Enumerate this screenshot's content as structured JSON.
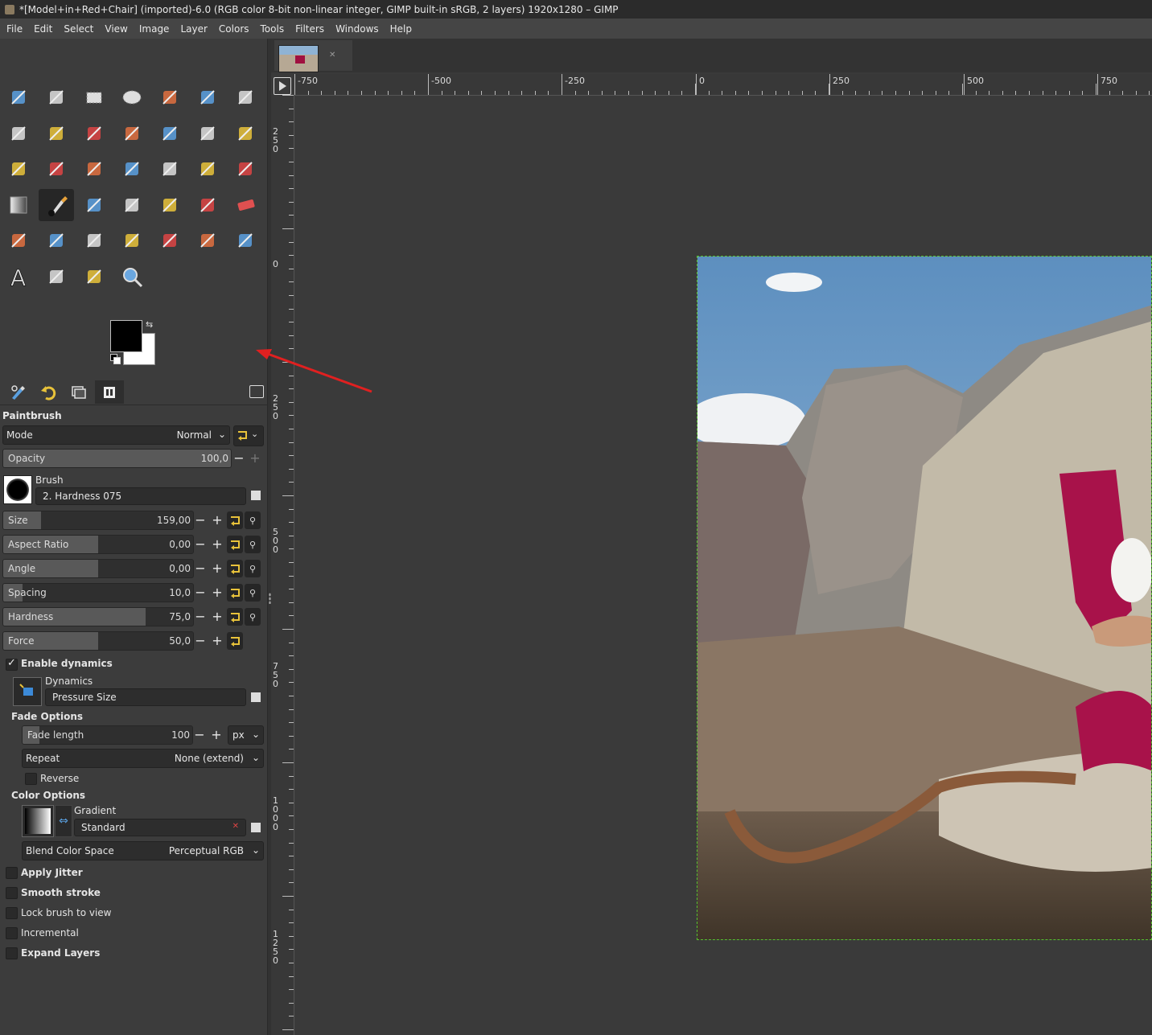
{
  "window": {
    "title": "*[Model+in+Red+Chair] (imported)-6.0 (RGB color 8-bit non-linear integer, GIMP built-in sRGB, 2 layers) 1920x1280 – GIMP"
  },
  "menu": [
    "File",
    "Edit",
    "Select",
    "View",
    "Image",
    "Layer",
    "Colors",
    "Tools",
    "Filters",
    "Windows",
    "Help"
  ],
  "tools": {
    "icons": [
      [
        "move-tool-icon",
        "align-tool-icon",
        "rect-select-icon",
        "ellipse-select-icon",
        "free-select-icon",
        "scissors-select-icon",
        "foreground-select-icon"
      ],
      [
        "fuzzy-select-icon",
        "select-by-color-icon",
        "paths-icon",
        "crop-icon",
        "unified-transform-icon",
        "scale-icon",
        "perspective-icon"
      ],
      [
        "flip-icon",
        "3d-transform-icon",
        "cage-transform-icon",
        "warp-transform-icon",
        "handle-transform-icon",
        "n-point-deformation-icon",
        "bucket-fill-icon"
      ],
      [
        "gradient-icon",
        "paintbrush-icon",
        "pencil-icon",
        "airbrush-icon",
        "ink-icon",
        "mypaint-brush-icon",
        "eraser-icon"
      ],
      [
        "clone-icon",
        "perspective-clone-icon",
        "heal-icon",
        "smudge-icon",
        "blur-sharpen-icon",
        "dodge-burn-icon",
        "color-picker-pro-icon"
      ],
      [
        "text-icon",
        "color-picker-icon",
        "measure-icon",
        "zoom-icon"
      ]
    ],
    "active": "paintbrush-icon"
  },
  "colors": {
    "foreground": "#000000",
    "background": "#ffffff"
  },
  "docktabs": [
    "tool-options-tab",
    "undo-history-tab",
    "layers-tab",
    "device-status-tab"
  ],
  "options": {
    "tool_name": "Paintbrush",
    "mode_label": "Mode",
    "mode_value": "Normal",
    "opacity": {
      "label": "Opacity",
      "value": "100,0",
      "fraction": 1.0
    },
    "brush_label": "Brush",
    "brush_value": "2. Hardness 075",
    "sliders": [
      {
        "label": "Size",
        "value": "159,00",
        "fraction": 0.2
      },
      {
        "label": "Aspect Ratio",
        "value": "0,00",
        "fraction": 0.5
      },
      {
        "label": "Angle",
        "value": "0,00",
        "fraction": 0.5
      },
      {
        "label": "Spacing",
        "value": "10,0",
        "fraction": 0.1
      },
      {
        "label": "Hardness",
        "value": "75,0",
        "fraction": 0.75
      },
      {
        "label": "Force",
        "value": "50,0",
        "fraction": 0.5
      }
    ],
    "enable_dynamics": "Enable dynamics",
    "dynamics_label": "Dynamics",
    "dynamics_value": "Pressure Size",
    "fade_options": "Fade Options",
    "fade_length_label": "Fade length",
    "fade_length_value": "100",
    "fade_unit": "px",
    "repeat_label": "Repeat",
    "repeat_value": "None (extend)",
    "reverse": "Reverse",
    "color_options": "Color Options",
    "gradient_label": "Gradient",
    "gradient_value": "Standard",
    "blend_label": "Blend Color Space",
    "blend_value": "Perceptual RGB",
    "apply_jitter": "Apply Jitter",
    "smooth_stroke": "Smooth stroke",
    "lock_brush": "Lock brush to view",
    "incremental": "Incremental",
    "expand_layers": "Expand Layers"
  },
  "rulers": {
    "horizontal": [
      "-750",
      "-500",
      "-250",
      "0",
      "250",
      "500",
      "750"
    ],
    "vertical": [
      "250",
      "0",
      "250",
      "500",
      "750",
      "1000",
      "1250"
    ]
  }
}
